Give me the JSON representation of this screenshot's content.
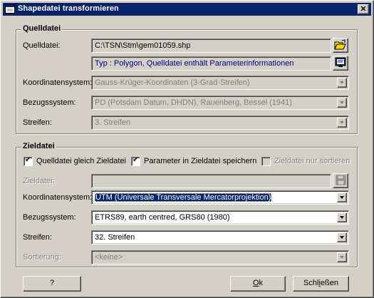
{
  "window": {
    "title": "Shapedatei transformieren",
    "close_label": "✕"
  },
  "source": {
    "group_title": "Quelldatei",
    "file_label": "Quelldatei:",
    "file_value": "C:\\TSN\\Stm\\gem01059.shp",
    "info_value": "Typ : Polygon, Quelldatei enthält Parameterinformationen",
    "coord_label": "Koordinatensystem:",
    "coord_value": "Gauss-Krüger-Koordinaten (3-Grad-Streifen)",
    "datum_label": "Bezugssystem:",
    "datum_value": "PD (Potsdam Datum, DHDN), Rauenberg, Bessel (1941)",
    "strip_label": "Streifen:",
    "strip_value": "3. Streifen"
  },
  "target": {
    "group_title": "Zieldatei",
    "check_same_label": "Quelldatei gleich Zieldatei",
    "check_same": true,
    "check_params_label": "Parameter in Zieldatei speichern",
    "check_params": true,
    "check_nosort_label": "Zieldatei nur sortieren",
    "check_nosort": false,
    "file_label": "Zieldatei:",
    "file_value": "",
    "coord_label": "Koordinatensystem:",
    "coord_value": "UTM (Universale Transversale Mercatorprojektion)",
    "datum_label": "Bezugssystem:",
    "datum_value": "ETRS89, earth centred, GRS80 (1980)",
    "strip_label": "Streifen:",
    "strip_value": "32. Streifen",
    "sort_label": "Sortierung:",
    "sort_value": "<keine>"
  },
  "buttons": {
    "help": "?",
    "ok_hotkey": "O",
    "ok_rest": "k",
    "close_pre": "Schl",
    "close_hotkey": "i",
    "close_rest": "eßen"
  },
  "icons": {
    "app": "window-icon",
    "open": "folder-open-icon",
    "info": "monitor-info-icon",
    "save": "floppy-disk-icon"
  }
}
